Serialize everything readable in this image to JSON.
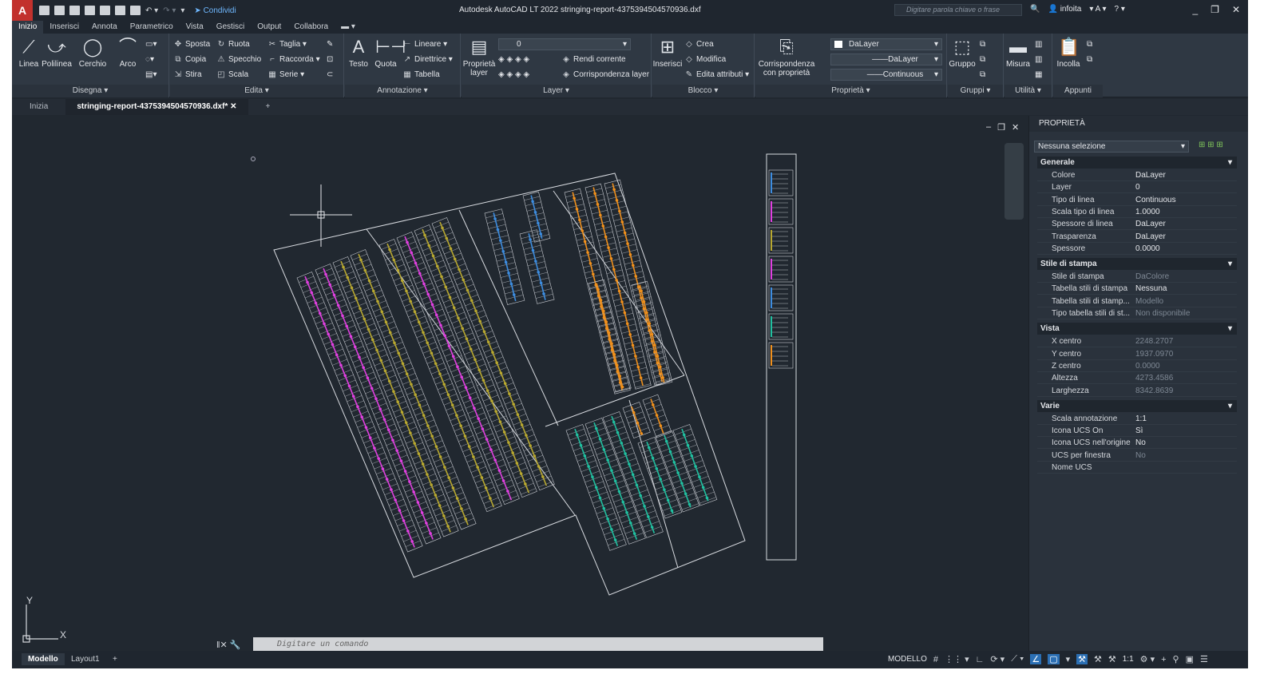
{
  "titlebar": {
    "logo": "A",
    "share": "Condividi",
    "app_title": "Autodesk AutoCAD LT 2022",
    "file_name": "stringing-report-4375394504570936.dxf",
    "search_placeholder": "Digitare parola chiave o frase",
    "user": "infoita"
  },
  "tabs": [
    "Inizio",
    "Inserisci",
    "Annota",
    "Parametrico",
    "Vista",
    "Gestisci",
    "Output",
    "Collabora"
  ],
  "ribbon": {
    "disegna": {
      "title": "Disegna",
      "linea": "Linea",
      "polilinea": "Polilinea",
      "cerchio": "Cerchio",
      "arco": "Arco"
    },
    "edita": {
      "title": "Edita",
      "sposta": "Sposta",
      "ruota": "Ruota",
      "taglia": "Taglia",
      "copia": "Copia",
      "specchio": "Specchio",
      "raccorda": "Raccorda",
      "stira": "Stira",
      "scala": "Scala",
      "serie": "Serie"
    },
    "annotazione": {
      "title": "Annotazione",
      "testo": "Testo",
      "quota": "Quota",
      "lineare": "Lineare",
      "direttrice": "Direttrice",
      "tabella": "Tabella"
    },
    "layer": {
      "title": "Layer",
      "proprieta": "Proprietà layer",
      "current_layer": "0",
      "rendi_corrente": "Rendi corrente",
      "corrispondenza": "Corrispondenza layer"
    },
    "blocco": {
      "title": "Blocco",
      "inserisci": "Inserisci",
      "crea": "Crea",
      "modifica": "Modifica",
      "edita_attributi": "Edita attributi"
    },
    "proprieta": {
      "title": "Proprietà",
      "corrispondenza": "Corrispondenza con proprietà",
      "color": "DaLayer",
      "lineweight": "DaLayer",
      "linetype": "Continuous"
    },
    "gruppi": {
      "title": "Gruppi",
      "gruppo": "Gruppo"
    },
    "utilita": {
      "title": "Utilità",
      "misura": "Misura"
    },
    "appunti": {
      "title": "Appunti",
      "incolla": "Incolla"
    }
  },
  "filetabs": {
    "start": "Inizia",
    "active": "stringing-report-4375394504570936.dxf*"
  },
  "canvas": {
    "ucs_y": "Y",
    "ucs_x": "X",
    "cmd_placeholder": "Digitare un comando"
  },
  "properties": {
    "header": "PROPRIETÀ",
    "selection": "Nessuna selezione",
    "sections": [
      {
        "title": "Generale",
        "rows": [
          {
            "k": "Colore",
            "v": "DaLayer"
          },
          {
            "k": "Layer",
            "v": "0"
          },
          {
            "k": "Tipo di linea",
            "v": "Continuous"
          },
          {
            "k": "Scala tipo di linea",
            "v": "1.0000"
          },
          {
            "k": "Spessore di linea",
            "v": "DaLayer"
          },
          {
            "k": "Trasparenza",
            "v": "DaLayer"
          },
          {
            "k": "Spessore",
            "v": "0.0000"
          }
        ]
      },
      {
        "title": "Stile di stampa",
        "rows": [
          {
            "k": "Stile di stampa",
            "v": "DaColore"
          },
          {
            "k": "Tabella stili di stampa",
            "v": "Nessuna"
          },
          {
            "k": "Tabella stili di stamp...",
            "v": "Modello"
          },
          {
            "k": "Tipo tabella stili di st...",
            "v": "Non disponibile"
          }
        ]
      },
      {
        "title": "Vista",
        "rows": [
          {
            "k": "X centro",
            "v": "2248.2707"
          },
          {
            "k": "Y centro",
            "v": "1937.0970"
          },
          {
            "k": "Z centro",
            "v": "0.0000"
          },
          {
            "k": "Altezza",
            "v": "4273.4586"
          },
          {
            "k": "Larghezza",
            "v": "8342.8639"
          }
        ]
      },
      {
        "title": "Varie",
        "rows": [
          {
            "k": "Scala annotazione",
            "v": "1:1"
          },
          {
            "k": "Icona UCS On",
            "v": "Sì"
          },
          {
            "k": "Icona UCS nell'origine",
            "v": "No"
          },
          {
            "k": "UCS per finestra",
            "v": "No"
          },
          {
            "k": "Nome UCS",
            "v": ""
          }
        ]
      }
    ]
  },
  "status": {
    "model": "Modello",
    "layout": "Layout1",
    "mode": "MODELLO",
    "scale": "1:1"
  },
  "colors": {
    "magenta": "#e040e0",
    "olive": "#b8a830",
    "blue": "#3d8de0",
    "orange": "#f0901c",
    "teal": "#20c0a0",
    "accent": "#2b6fb4"
  }
}
